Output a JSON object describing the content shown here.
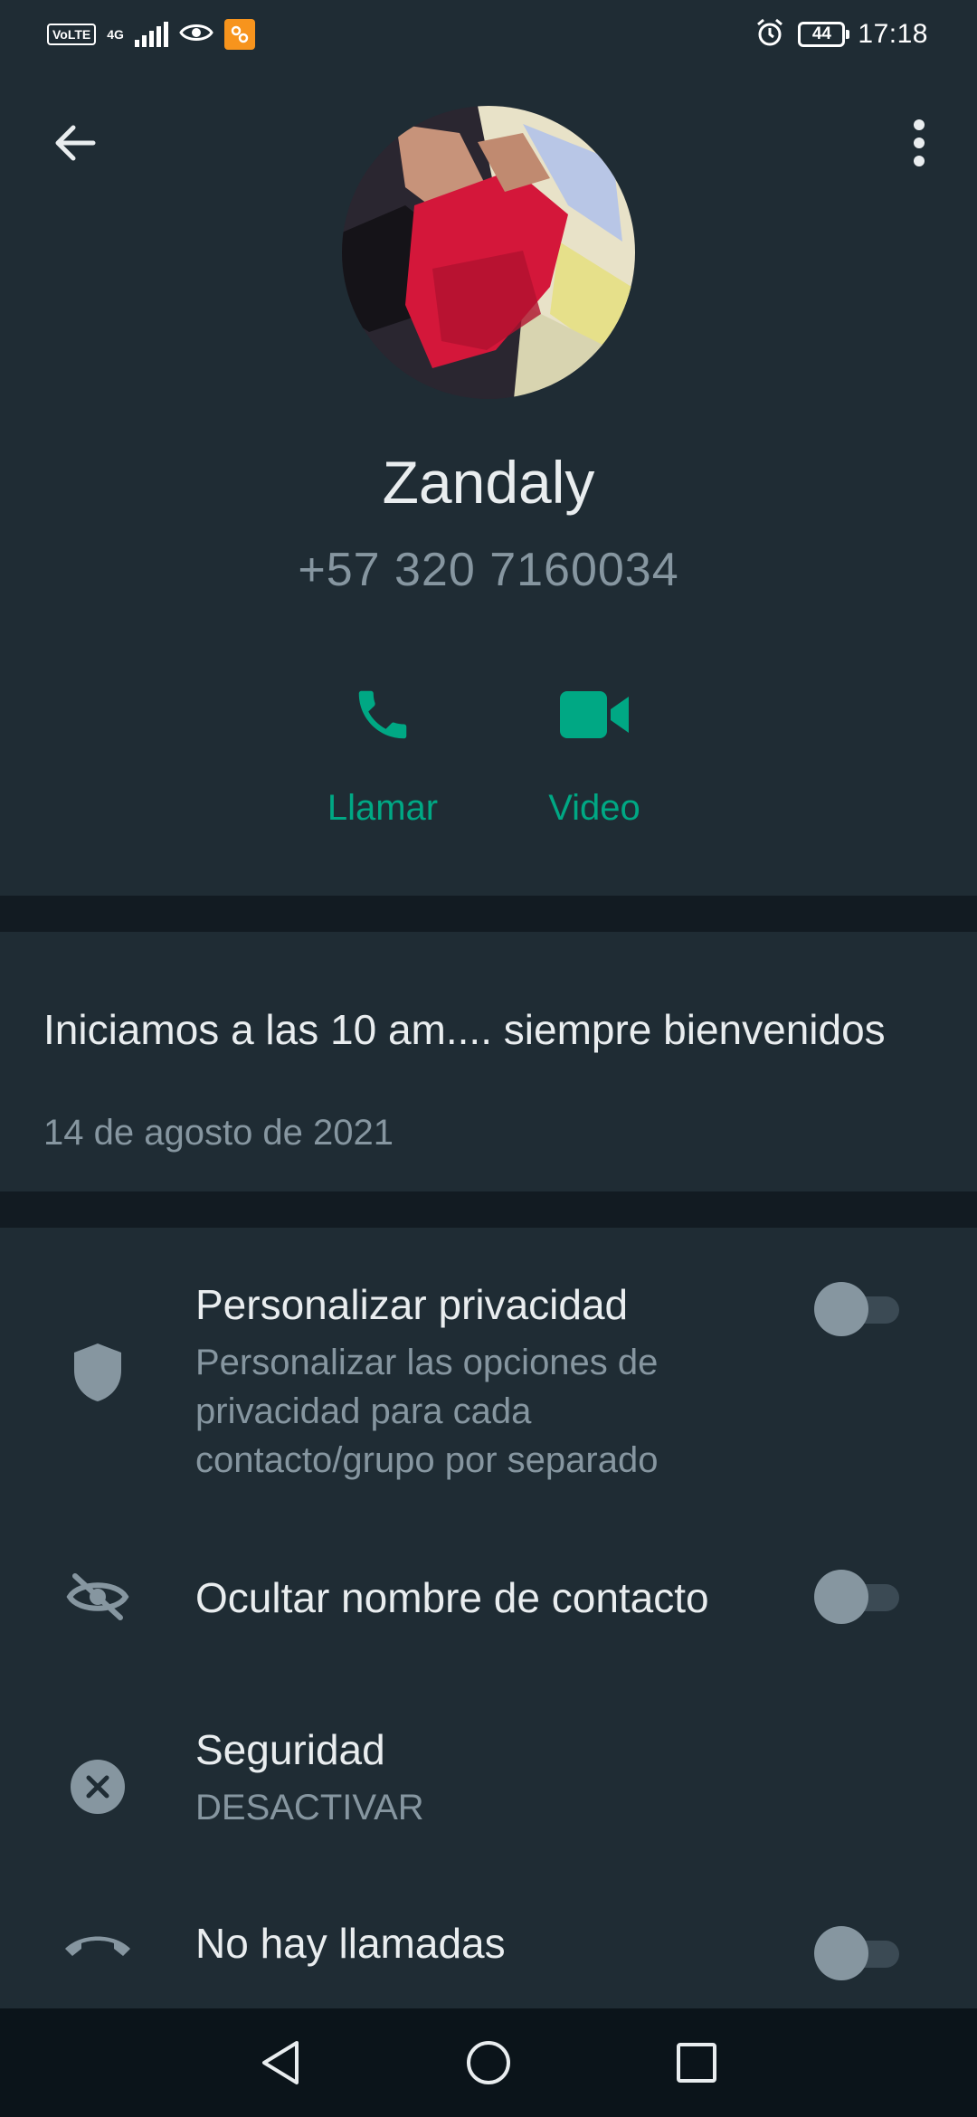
{
  "status_bar": {
    "volte": "VoLTE",
    "network": "4G",
    "battery": "44",
    "time": "17:18"
  },
  "header": {
    "back_icon": "arrow-left-icon",
    "more_icon": "more-vert-icon"
  },
  "contact": {
    "name": "Zandaly",
    "phone": "+57 320 7160034"
  },
  "actions": {
    "call_label": "Llamar",
    "video_label": "Video"
  },
  "about": {
    "text": "Iniciamos a las 10 am.... siempre bienvenidos",
    "date": "14 de agosto de 2021"
  },
  "settings": {
    "custom_privacy": {
      "icon": "shield-icon",
      "title": "Personalizar privacidad",
      "subtitle": "Personalizar las opciones de privacidad para cada contacto/grupo por separado",
      "enabled": false
    },
    "hide_name": {
      "icon": "eye-off-icon",
      "title": "Ocultar nombre de contacto",
      "enabled": false
    },
    "security": {
      "icon": "close-circle-icon",
      "title": "Seguridad",
      "subtitle": "DESACTIVAR"
    },
    "no_calls": {
      "icon": "phone-hangup-icon",
      "title": "No hay llamadas",
      "enabled": false
    }
  },
  "nav": {
    "back_icon": "nav-back-icon",
    "home_icon": "nav-home-icon",
    "recents_icon": "nav-recents-icon"
  },
  "colors": {
    "accent": "#00a884",
    "background": "#121b22",
    "surface": "#1f2c34",
    "secondary_text": "#8696a0"
  }
}
